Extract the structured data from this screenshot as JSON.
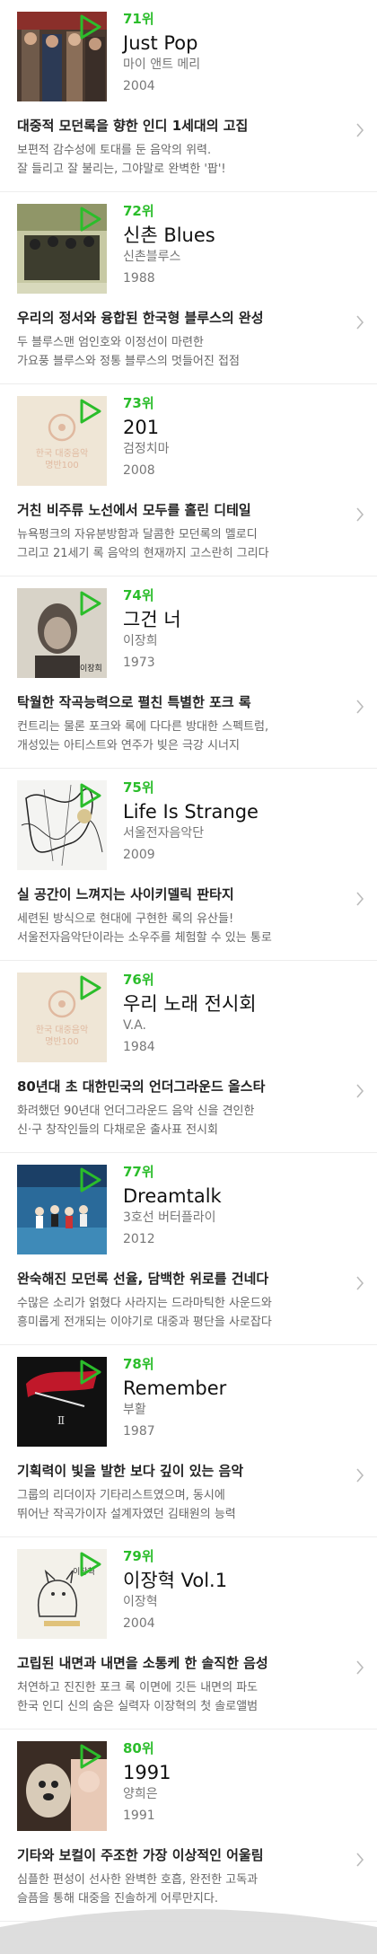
{
  "items": [
    {
      "rank": "71위",
      "title": "Just Pop",
      "artist": "마이 앤트 메리",
      "year": "2004",
      "headline": "대중적 모던록을 향한 인디 1세대의 고집",
      "desc1": "보편적 감수성에 토대를 둔 음악의 위력.",
      "desc2": "잘 들리고 잘 불리는, 그야말로 완벽한 '팝'!",
      "cover_style": "photo-crowd"
    },
    {
      "rank": "72위",
      "title": "신촌 Blues",
      "artist": "신촌블루스",
      "year": "1988",
      "headline": "우리의 정서와 융합된 한국형 블루스의 완성",
      "desc1": "두 블루스맨 엄인호와 이정선이 마련한",
      "desc2": "가요풍 블루스와 정통 블루스의 멋들어진 접점",
      "cover_style": "photo-band-green"
    },
    {
      "rank": "73위",
      "title": "201",
      "artist": "검정치마",
      "year": "2008",
      "headline": "거친 비주류 노선에서 모두를 홀린 디테일",
      "desc1": "뉴욕펑크의 자유분방함과 달콤한 모던록의 멜로디",
      "desc2": "그리고 21세기 록 음악의 현재까지 고스란히 그리다",
      "cover_style": "placeholder",
      "placeholder_line1": "한국 대중음악",
      "placeholder_line2": "명반100"
    },
    {
      "rank": "74위",
      "title": "그건 너",
      "artist": "이장희",
      "year": "1973",
      "headline": "탁월한 작곡능력으로 펼친 특별한 포크 록",
      "desc1": "컨트리는 물론 포크와 록에 다다른 방대한 스펙트럼,",
      "desc2": "개성있는 아티스트와 연주가 빚은 극강 시너지",
      "cover_style": "photo-portrait"
    },
    {
      "rank": "75위",
      "title": "Life Is Strange",
      "artist": "서울전자음악단",
      "year": "2009",
      "headline": "실 공간이 느껴지는 사이키델릭 판타지",
      "desc1": "세련된 방식으로 현대에 구현한 록의 유산들!",
      "desc2": "서울전자음악단이라는 소우주를 체험할 수 있는 통로",
      "cover_style": "sketch"
    },
    {
      "rank": "76위",
      "title": "우리 노래 전시회",
      "artist": "V.A.",
      "year": "1984",
      "headline": "80년대 초 대한민국의 언더그라운드 올스타",
      "desc1": "화려했던 90년대 언더그라운드 음악 신을 견인한",
      "desc2": "신·구 창작인들의 다채로운 출사표 전시회",
      "cover_style": "placeholder",
      "placeholder_line1": "한국 대중음악",
      "placeholder_line2": "명반100"
    },
    {
      "rank": "77위",
      "title": "Dreamtalk",
      "artist": "3호선 버터플라이",
      "year": "2012",
      "headline": "완숙해진 모던록 선율, 담백한 위로를 건네다",
      "desc1": "수많은 소리가 얽혔다 사라지는 드라마틱한 사운드와",
      "desc2": "흥미롭게 전개되는 이야기로 대중과 평단을 사로잡다",
      "cover_style": "photo-blue-band"
    },
    {
      "rank": "78위",
      "title": "Remember",
      "artist": "부활",
      "year": "1987",
      "headline": "기획력이 빛을 발한 보다 깊이 있는 음악",
      "desc1": "그룹의 리더이자 기타리스트였으며, 동시에",
      "desc2": "뛰어난 작곡가이자 설계자였던 김태원의 능력",
      "cover_style": "dark-red"
    },
    {
      "rank": "79위",
      "title": "이장혁 Vol.1",
      "artist": "이장혁",
      "year": "2004",
      "headline": "고립된 내면과 내면을 소통케 한 솔직한 음성",
      "desc1": "처연하고 진진한 포크 록 이면에 깃든 내면의 파도",
      "desc2": "한국 인디 신의 숨은 실력자 이장혁의 첫 솔로앨범",
      "cover_style": "drawing-cat"
    },
    {
      "rank": "80위",
      "title": "1991",
      "artist": "양희은",
      "year": "1991",
      "headline": "기타와 보컬이 주조한 가장 이상적인 어울림",
      "desc1": "심플한 편성이 선사한 완벽한 호흡, 완전한 고독과",
      "desc2": "슬픔을 통해 대중을 진솔하게 어루만지다.",
      "cover_style": "photo-dog"
    }
  ],
  "colors": {
    "accent_green": "#2bbd2b",
    "text_main": "#111111",
    "text_sub": "#777777",
    "divider": "#ededed"
  },
  "icons": {
    "play": "play-triangle-icon",
    "chevron": "chevron-right-icon"
  }
}
